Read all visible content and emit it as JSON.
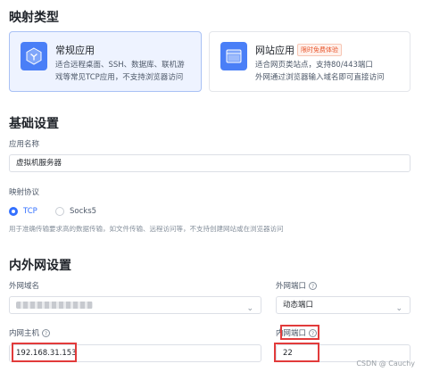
{
  "mapping_type": {
    "title": "映射类型",
    "cards": [
      {
        "title": "常规应用",
        "desc": "适合远程桌面、SSH、数据库、联机游\n戏等常见TCP应用，不支持浏览器访问",
        "selected": true,
        "icon": "cube-icon"
      },
      {
        "title": "网站应用",
        "badge": "限时免费体验",
        "desc": "适合网页类站点，支持80/443端口\n外网通过浏览器输入域名即可直接访问",
        "selected": false,
        "icon": "browser-window-icon"
      }
    ]
  },
  "basic": {
    "title": "基础设置",
    "app_name_label": "应用名称",
    "app_name_value": "虚拟机服务器",
    "protocol_label": "映射协议",
    "protocols": [
      "TCP",
      "Socks5"
    ],
    "selected_protocol": "TCP",
    "protocol_hint": "用于准确传输要求高的数据传输，如文件传输、远程访问等，不支持创建网站或在浏览器访问"
  },
  "network": {
    "title": "内外网设置",
    "external_domain_label": "外网域名",
    "external_port_label": "外网端口",
    "external_port_value": "动态端口",
    "internal_host_label": "内网主机",
    "internal_host_value": "192.168.31.153",
    "internal_port_label": "内网端口",
    "internal_port_value": "22"
  },
  "watermark": "CSDN @ Cauchy",
  "colors": {
    "accent": "#3370ff",
    "highlight": "#e23b3b",
    "badge": "#e8552b"
  }
}
